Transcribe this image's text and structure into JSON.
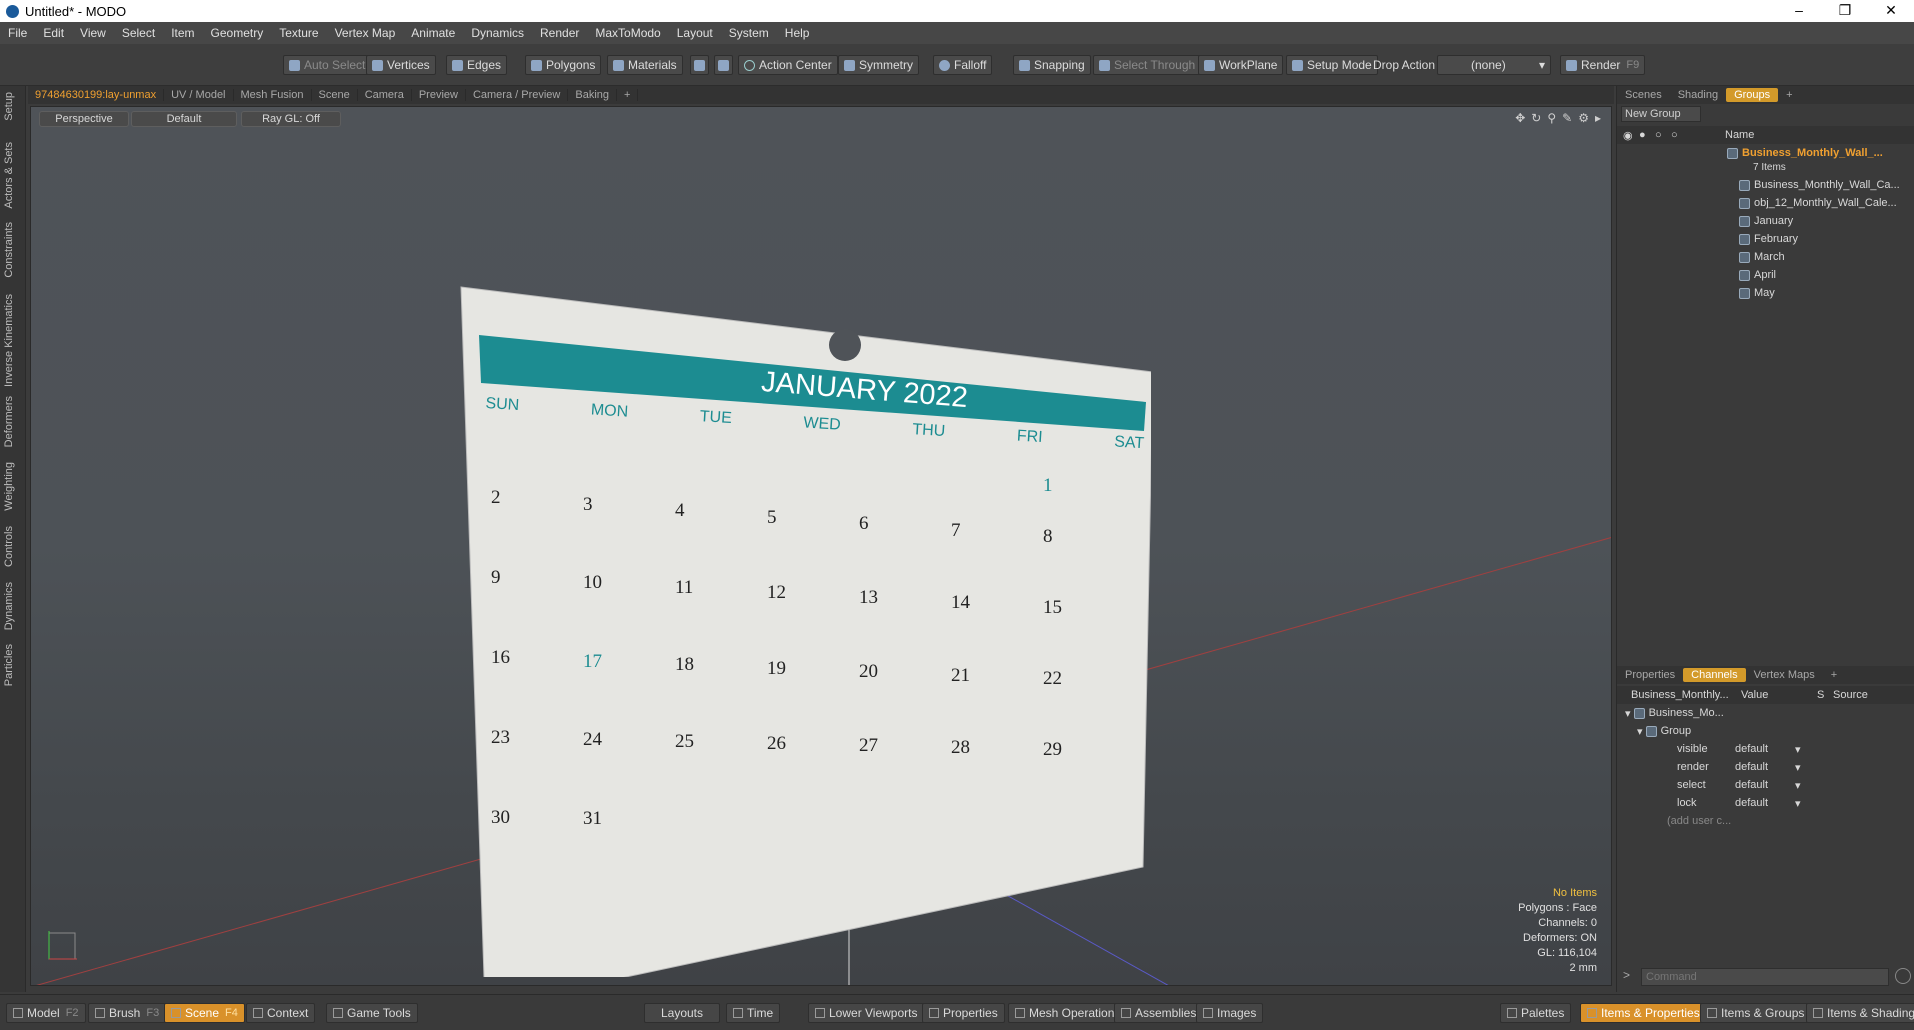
{
  "window": {
    "title": "Untitled* - MODO"
  },
  "menu": [
    "File",
    "Edit",
    "View",
    "Select",
    "Item",
    "Geometry",
    "Texture",
    "Vertex Map",
    "Animate",
    "Dynamics",
    "Render",
    "MaxToModo",
    "Layout",
    "System",
    "Help"
  ],
  "toolbar": {
    "auto_select": "Auto Select",
    "vertices": "Vertices",
    "edges": "Edges",
    "polygons": "Polygons",
    "materials": "Materials",
    "action_center": "Action Center",
    "symmetry": "Symmetry",
    "falloff": "Falloff",
    "snapping": "Snapping",
    "select_through": "Select Through",
    "workplane": "WorkPlane",
    "setup_mode": "Setup Mode",
    "drop_action": "Drop Action",
    "drop_value": "(none)",
    "render": "Render",
    "render_key": "F9"
  },
  "left_tabs": [
    "Setup",
    "Actors & Sets",
    "Constraints",
    "Inverse Kinematics",
    "Deformers",
    "Weighting",
    "Controls",
    "Dynamics",
    "Particles"
  ],
  "viewport_tabs": [
    "97484630199:lay-unmax",
    "UV / Model",
    "Mesh Fusion",
    "Scene",
    "Camera",
    "Preview",
    "Camera / Preview",
    "Baking",
    "+"
  ],
  "viewport": {
    "view": "Perspective",
    "shading": "Default",
    "raygl": "Ray GL: Off",
    "info": [
      "No Items",
      "Polygons : Face",
      "Channels: 0",
      "Deformers: ON",
      "GL: 116,104",
      "2 mm"
    ]
  },
  "calendar": {
    "title": "JANUARY 2022",
    "days": [
      "SUN",
      "MON",
      "TUE",
      "WED",
      "THU",
      "FRI",
      "SAT"
    ],
    "dates": [
      "1",
      "2",
      "3",
      "4",
      "5",
      "6",
      "7",
      "8",
      "9",
      "10",
      "11",
      "12",
      "13",
      "14",
      "15",
      "16",
      "17",
      "18",
      "19",
      "20",
      "21",
      "22",
      "23",
      "24",
      "25",
      "26",
      "27",
      "28",
      "29",
      "30",
      "31"
    ],
    "accent": "#1c8c91"
  },
  "right_top_tabs": [
    "Scenes",
    "Shading",
    "Groups",
    "+"
  ],
  "groups": {
    "new_group": "New Group",
    "col_name": "Name",
    "root": "Business_Monthly_Wall_...",
    "count": "7 Items",
    "items": [
      "Business_Monthly_Wall_Ca...",
      "obj_12_Monthly_Wall_Cale...",
      "January",
      "February",
      "March",
      "April",
      "May"
    ]
  },
  "right_bottom_tabs": [
    "Properties",
    "Channels",
    "Vertex Maps",
    "+"
  ],
  "channels": {
    "col_item": "Business_Monthly...",
    "col_value": "Value",
    "col_s": "S",
    "col_source": "Source",
    "root": "Business_Mo...",
    "group": "Group",
    "rows": [
      {
        "name": "visible",
        "value": "default"
      },
      {
        "name": "render",
        "value": "default"
      },
      {
        "name": "select",
        "value": "default"
      },
      {
        "name": "lock",
        "value": "default"
      }
    ],
    "add": "(add user c..."
  },
  "command": {
    "placeholder": "Command"
  },
  "status": {
    "model": "Model",
    "model_key": "F2",
    "brush": "Brush",
    "brush_key": "F3",
    "scene": "Scene",
    "scene_key": "F4",
    "context": "Context",
    "game_tools": "Game Tools",
    "layouts": "Layouts",
    "time": "Time",
    "lower_viewports": "Lower Viewports",
    "properties": "Properties",
    "mesh_operations": "Mesh Operations",
    "assemblies": "Assemblies",
    "images": "Images",
    "palettes": "Palettes",
    "items_properties": "Items & Properties",
    "items_groups": "Items & Groups",
    "items_shading": "Items & Shading"
  }
}
